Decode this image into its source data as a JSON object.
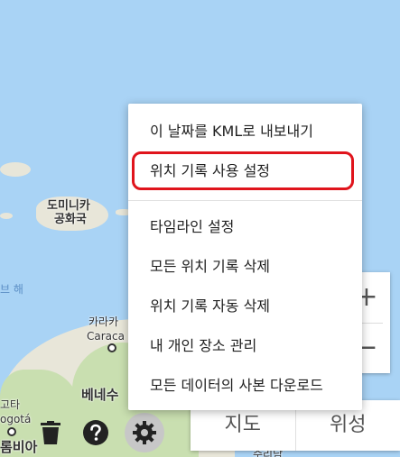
{
  "menu": {
    "items": [
      "이 날짜를 KML로 내보내기",
      "위치 기록 사용 설정",
      "타임라인 설정",
      "모든 위치 기록 삭제",
      "위치 기록 자동 삭제",
      "내 개인 장소 관리",
      "모든 데이터의 사본 다운로드"
    ],
    "highlighted_item": "위치 기록 사용 설정",
    "highlight_color": "#e0141c"
  },
  "map": {
    "labels": {
      "dominican": "도미니카",
      "dominican2": "공화국",
      "caribbean_sea": "브 해",
      "caracas_ko": "카라카",
      "caracas_en": "Caraca",
      "venezuela": "베네수",
      "bogota_ko": "고타",
      "bogota_en": "ogotá",
      "colombia": "롬비아",
      "bottom_partial": "수리남"
    },
    "water_color": "#a9d3f5"
  },
  "zoom": {
    "in_label": "+",
    "out_label": "−"
  },
  "map_type": {
    "map_label": "지도",
    "satellite_label": "위성"
  },
  "tools": [
    "trash-icon",
    "help-icon",
    "gear-icon"
  ]
}
